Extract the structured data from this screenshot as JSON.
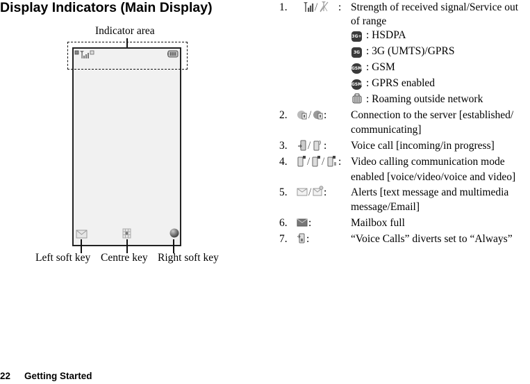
{
  "page": {
    "title": "Display Indicators (Main Display)",
    "footer": {
      "page_number": "22",
      "section": "Getting Started"
    }
  },
  "diagram": {
    "indicator_area_label": "Indicator area",
    "left_soft_key_label": "Left soft key",
    "centre_key_label": "Centre key",
    "right_soft_key_label": "Right soft key",
    "status_icons": [
      "network-icon",
      "signal-strength-icon",
      "small-square-icon",
      "battery-icon"
    ],
    "soft_key_icons": [
      "envelope-icon",
      "grid-menu-icon",
      "globe-icon"
    ]
  },
  "indicators": [
    {
      "num": "1.",
      "icons": [
        "signal-strength-icon",
        "no-service-icon"
      ],
      "sep": ":",
      "lines": [
        "Strength of received signal/Service out",
        "of range"
      ],
      "sub": [
        {
          "icon": "hsdpa-icon",
          "badge": "3G+",
          "text": ": HSDPA"
        },
        {
          "icon": "3g-umts-icon",
          "badge": "3G",
          "text": ": 3G (UMTS)/GPRS"
        },
        {
          "icon": "gsm-icon",
          "badge": "GSM",
          "text": ": GSM"
        },
        {
          "icon": "gprs-enabled-icon",
          "badge": "GSM",
          "text": ": GPRS enabled"
        },
        {
          "icon": "roaming-icon",
          "badge": "",
          "text": ": Roaming outside network"
        }
      ]
    },
    {
      "num": "2.",
      "icons": [
        "server-established-icon",
        "server-communicating-icon"
      ],
      "sep": ":",
      "lines": [
        "Connection to the server [established/",
        "communicating]"
      ]
    },
    {
      "num": "3.",
      "icons": [
        "incoming-call-icon",
        "call-in-progress-icon"
      ],
      "sep": ":",
      "lines": [
        "Voice call [incoming/in progress]"
      ]
    },
    {
      "num": "4.",
      "icons": [
        "video-voice-icon",
        "video-video-icon",
        "video-voice-and-video-icon"
      ],
      "sep": ":",
      "lines": [
        "Video calling communication mode",
        "enabled [voice/video/voice and video]"
      ]
    },
    {
      "num": "5.",
      "icons": [
        "text-message-alert-icon",
        "multimedia-email-alert-icon"
      ],
      "sep": ":",
      "lines": [
        "Alerts [text message and multimedia",
        "message/Email]"
      ]
    },
    {
      "num": "6.",
      "icons": [
        "mailbox-full-icon"
      ],
      "sep": ":",
      "lines": [
        "Mailbox full"
      ]
    },
    {
      "num": "7.",
      "icons": [
        "divert-always-icon"
      ],
      "sep": ":",
      "lines": [
        "“Voice Calls” diverts set to “Always”"
      ]
    }
  ]
}
